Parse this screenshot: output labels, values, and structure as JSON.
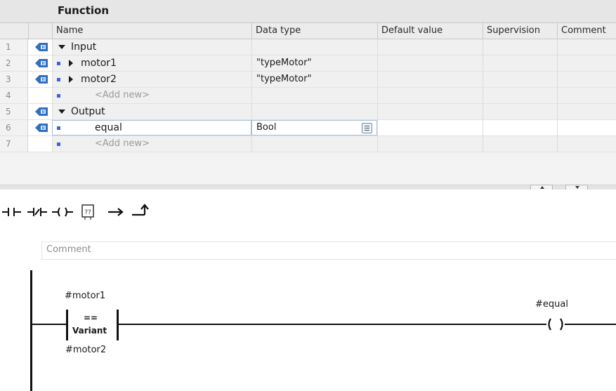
{
  "block": {
    "title": "Function"
  },
  "columns": [
    {
      "key": "name",
      "label": "Name"
    },
    {
      "key": "type",
      "label": "Data type"
    },
    {
      "key": "default",
      "label": "Default value"
    },
    {
      "key": "supervision",
      "label": "Supervision"
    },
    {
      "key": "comment",
      "label": "Comment"
    }
  ],
  "rows": [
    {
      "num": "1",
      "icon": "input-section-icon",
      "expander": "expanded",
      "name": "Input",
      "type": ""
    },
    {
      "num": "2",
      "icon": "input-param-icon",
      "expander": "collapsed",
      "name": "motor1",
      "type": "\"typeMotor\""
    },
    {
      "num": "3",
      "icon": "input-param-icon",
      "expander": "collapsed",
      "name": "motor2",
      "type": "\"typeMotor\""
    },
    {
      "num": "4",
      "icon": "",
      "expander": "",
      "name": "<Add new>",
      "type": ""
    },
    {
      "num": "5",
      "icon": "output-section-icon",
      "expander": "expanded",
      "name": "Output",
      "type": ""
    },
    {
      "num": "6",
      "icon": "output-param-icon",
      "expander": "",
      "name": "equal",
      "type": "Bool"
    },
    {
      "num": "7",
      "icon": "",
      "expander": "",
      "name": "<Add new>",
      "type": ""
    }
  ],
  "toolbar": [
    "normally-open-contact",
    "normally-closed-contact",
    "output-coil",
    "empty-box",
    "open-branch",
    "close-branch"
  ],
  "network": {
    "comment_placeholder": "Comment",
    "box": {
      "operator": "==",
      "type_label": "Variant",
      "in1": "#motor1",
      "in2": "#motor2"
    },
    "coil": {
      "operand": "#equal"
    }
  },
  "colors": {
    "accent_blue": "#3b63d6",
    "header_bg": "#ececec",
    "selection_outline": "#a7c0dd"
  }
}
